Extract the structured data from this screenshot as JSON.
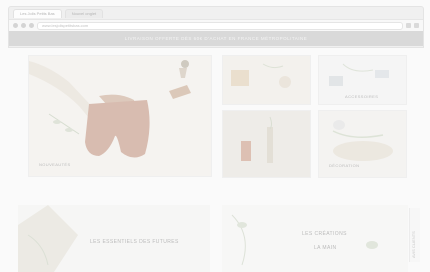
{
  "browser": {
    "tabs": [
      "Les Jolis Petits Bas",
      "Nouvel onglet"
    ],
    "url": "www.lesjolispetitsbas.com"
  },
  "announcement": "LIVRAISON OFFERTE DÈS 60€ D'ACHAT EN FRANCE MÉTROPOLITAINE",
  "tiles": {
    "hero_label": "NOUVEAUTÉS",
    "top_right_label": "ACCESSOIRES",
    "bottom_right_label": "DÉCORATION"
  },
  "banners": {
    "left_title": "LES ESSENTIELS DES FUTURES",
    "right_title_line1": "LES CRÉATIONS",
    "right_title_line2": "LA MAIN"
  },
  "side_tab": "AVIS CLIENTS"
}
